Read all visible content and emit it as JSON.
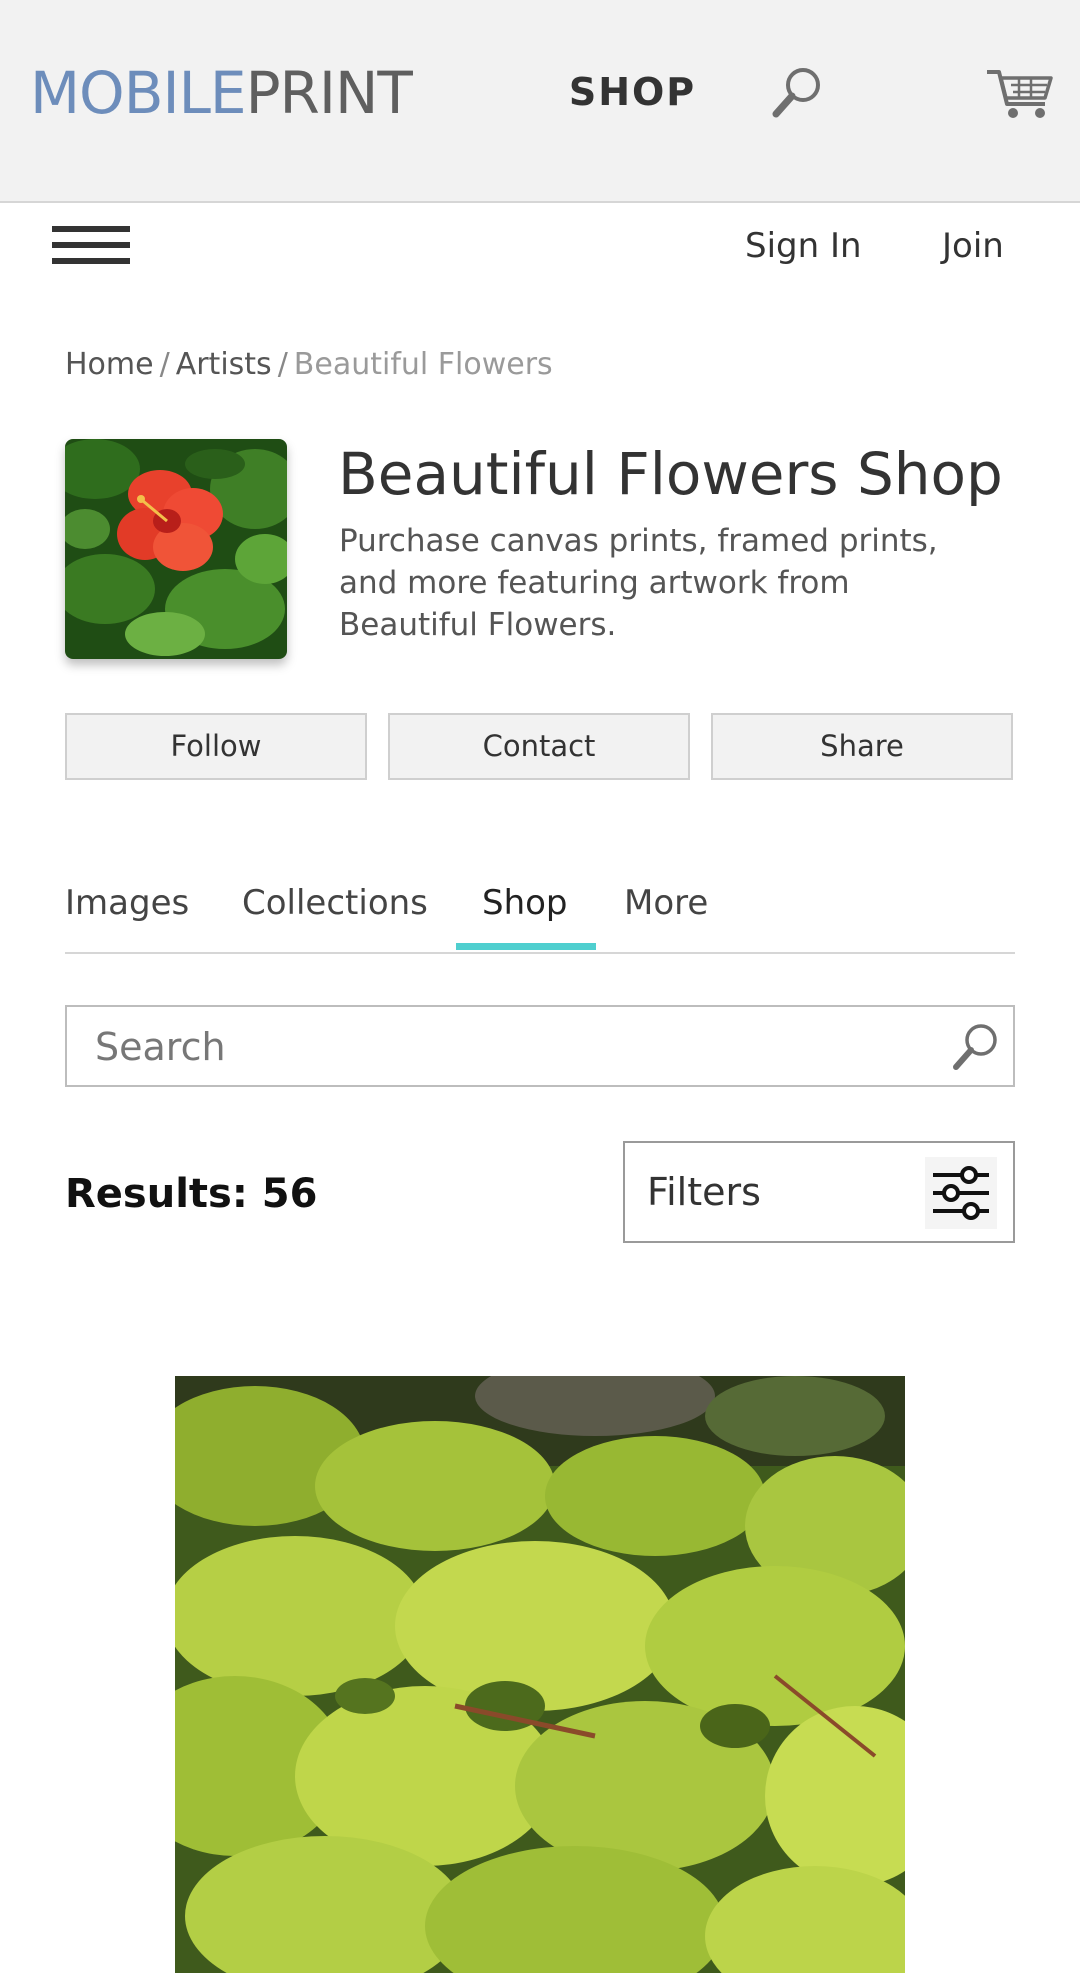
{
  "header": {
    "logo_part1": "MOBILE",
    "logo_part2": "PRINT",
    "shop_label": "SHOP",
    "icons": {
      "search": "search-icon",
      "cart": "cart-icon"
    }
  },
  "nav": {
    "menu_icon": "hamburger-menu-icon",
    "sign_in": "Sign In",
    "join": "Join"
  },
  "breadcrumb": {
    "items": [
      "Home",
      "Artists",
      "Beautiful Flowers"
    ],
    "separator": "/"
  },
  "shop": {
    "title": "Beautiful Flowers Shop",
    "description": "Purchase canvas prints, framed prints, and more featuring artwork from Beautiful Flowers."
  },
  "actions": {
    "follow": "Follow",
    "contact": "Contact",
    "share": "Share"
  },
  "tabs": {
    "items": [
      "Images",
      "Collections",
      "Shop",
      "More"
    ],
    "active": "Shop"
  },
  "search": {
    "placeholder": "Search",
    "value": ""
  },
  "results": {
    "label": "Results: 56"
  },
  "filters": {
    "label": "Filters",
    "icon": "sliders-icon"
  },
  "colors": {
    "logo_blue": "#6d8dbb",
    "logo_gray": "#5f5f5f",
    "tab_accent": "#4fcfcf",
    "header_bg": "#f2f2f2"
  }
}
